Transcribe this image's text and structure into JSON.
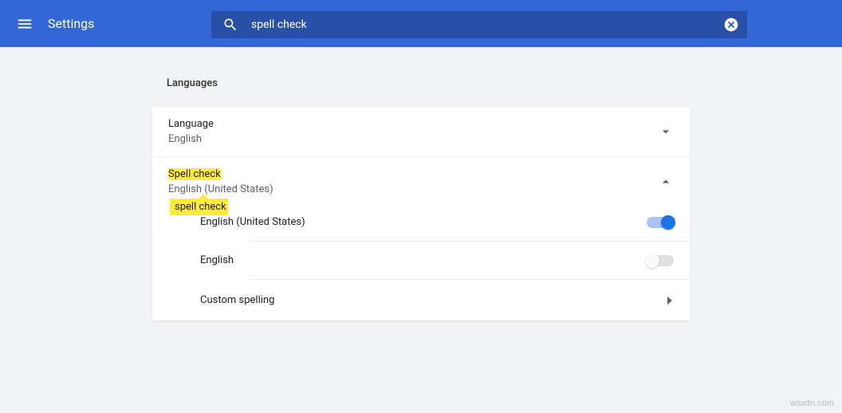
{
  "header": {
    "title": "Settings",
    "search_value": "spell check"
  },
  "section": {
    "title": "Languages"
  },
  "language_row": {
    "label": "Language",
    "sub": "English"
  },
  "spellcheck_row": {
    "label": "Spell check",
    "sub": "English (United States)"
  },
  "tip": {
    "label": "spell check"
  },
  "items": {
    "en_us": "English (United States)",
    "en": "English",
    "custom": "Custom spelling"
  },
  "watermark": "wsxdn.com"
}
